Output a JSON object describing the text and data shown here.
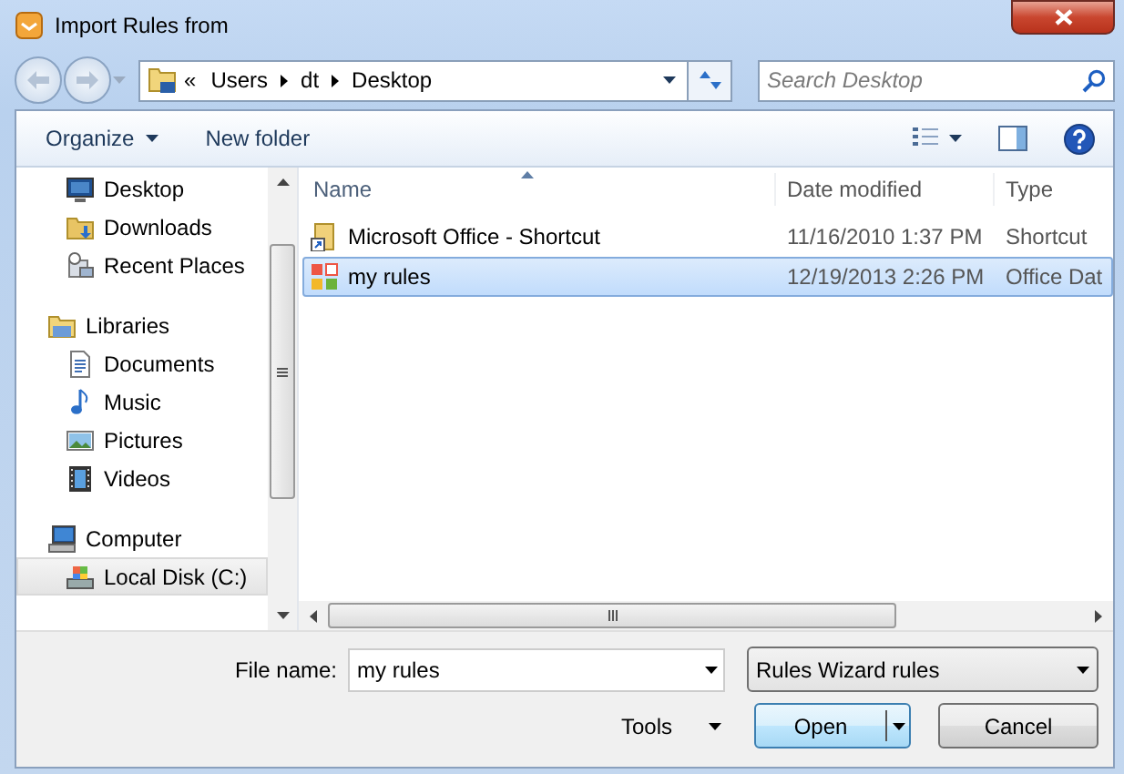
{
  "window": {
    "title": "Import Rules from"
  },
  "address": {
    "overflow": "«",
    "crumbs": [
      "Users",
      "dt",
      "Desktop"
    ]
  },
  "search": {
    "placeholder": "Search Desktop"
  },
  "toolbar": {
    "organize": "Organize",
    "new_folder": "New folder"
  },
  "nav": {
    "favorites": [
      {
        "label": "Desktop",
        "kind": "desktop",
        "selected": false
      },
      {
        "label": "Downloads",
        "kind": "downloads",
        "selected": false
      },
      {
        "label": "Recent Places",
        "kind": "recent",
        "selected": false
      }
    ],
    "tree": [
      {
        "label": "Libraries",
        "kind": "library",
        "selected": false,
        "children": [
          {
            "label": "Documents",
            "kind": "documents",
            "selected": false
          },
          {
            "label": "Music",
            "kind": "music",
            "selected": false
          },
          {
            "label": "Pictures",
            "kind": "pictures",
            "selected": false
          },
          {
            "label": "Videos",
            "kind": "videos",
            "selected": false
          }
        ]
      },
      {
        "label": "Computer",
        "kind": "computer",
        "selected": false,
        "children": [
          {
            "label": "Local Disk (C:)",
            "kind": "disk",
            "selected": true
          }
        ]
      }
    ]
  },
  "files": {
    "columns": [
      "Name",
      "Date modified",
      "Type"
    ],
    "rows": [
      {
        "name": "Microsoft Office - Shortcut",
        "date": "11/16/2010 1:37 PM",
        "type": "Shortcut",
        "kind": "shortcut",
        "selected": false
      },
      {
        "name": "my rules",
        "date": "12/19/2013 2:26 PM",
        "type": "Office Dat",
        "kind": "rules",
        "selected": true
      }
    ]
  },
  "footer": {
    "file_name_label": "File name:",
    "file_name": "my rules",
    "filter": "Rules Wizard rules",
    "tools": "Tools",
    "open": "Open",
    "cancel": "Cancel"
  }
}
